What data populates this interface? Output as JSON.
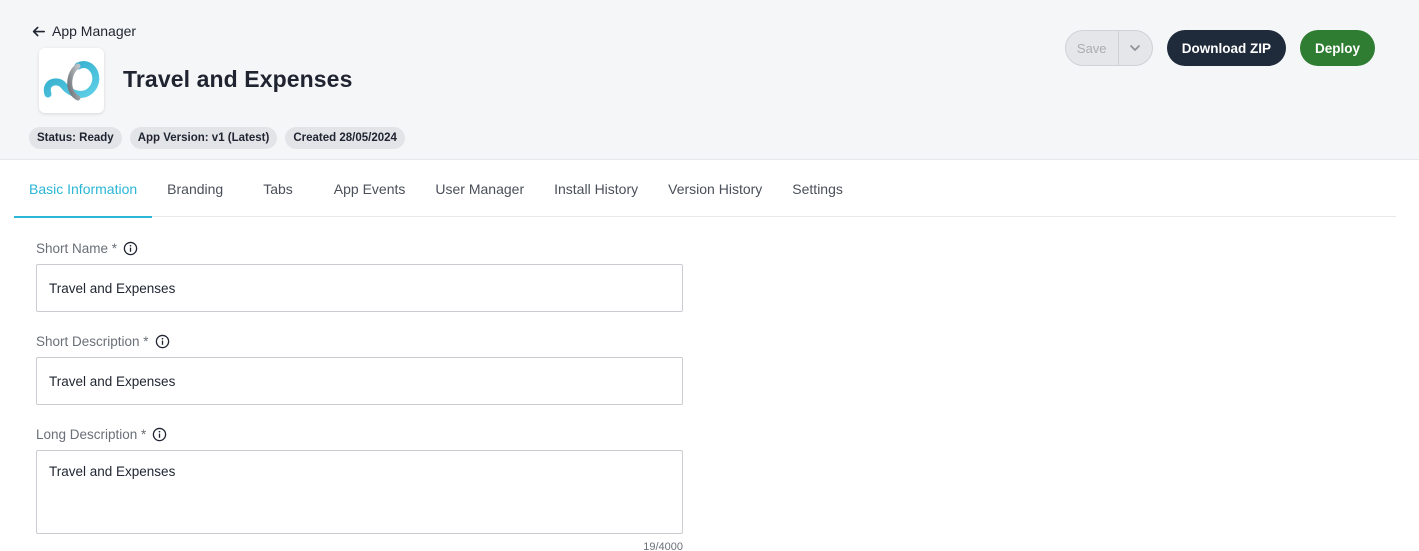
{
  "header": {
    "back_label": "App Manager",
    "app_title": "Travel and Expenses",
    "badges": {
      "status": "Status: Ready",
      "version": "App Version: v1 (Latest)",
      "created": "Created 28/05/2024"
    },
    "actions": {
      "save_label": "Save",
      "download_label": "Download ZIP",
      "deploy_label": "Deploy"
    }
  },
  "tabs": [
    {
      "label": "Basic Information",
      "active": true
    },
    {
      "label": "Branding"
    },
    {
      "label": "Tabs"
    },
    {
      "label": "App Events"
    },
    {
      "label": "User Manager"
    },
    {
      "label": "Install History"
    },
    {
      "label": "Version History"
    },
    {
      "label": "Settings"
    }
  ],
  "form": {
    "short_name": {
      "label": "Short Name *",
      "value": "Travel and Expenses"
    },
    "short_description": {
      "label": "Short Description *",
      "value": "Travel and Expenses"
    },
    "long_description": {
      "label": "Long Description *",
      "value": "Travel and Expenses",
      "counter": "19/4000"
    }
  },
  "colors": {
    "accent": "#2bb6d6",
    "dark_button": "#1f2a3a",
    "deploy_button": "#2f7d32",
    "header_bg": "#f5f6f8"
  },
  "icons": {
    "back": "arrow-left-icon",
    "save_menu": "chevron-down-icon",
    "info": "info-icon",
    "logo": "app-logo-icon"
  }
}
